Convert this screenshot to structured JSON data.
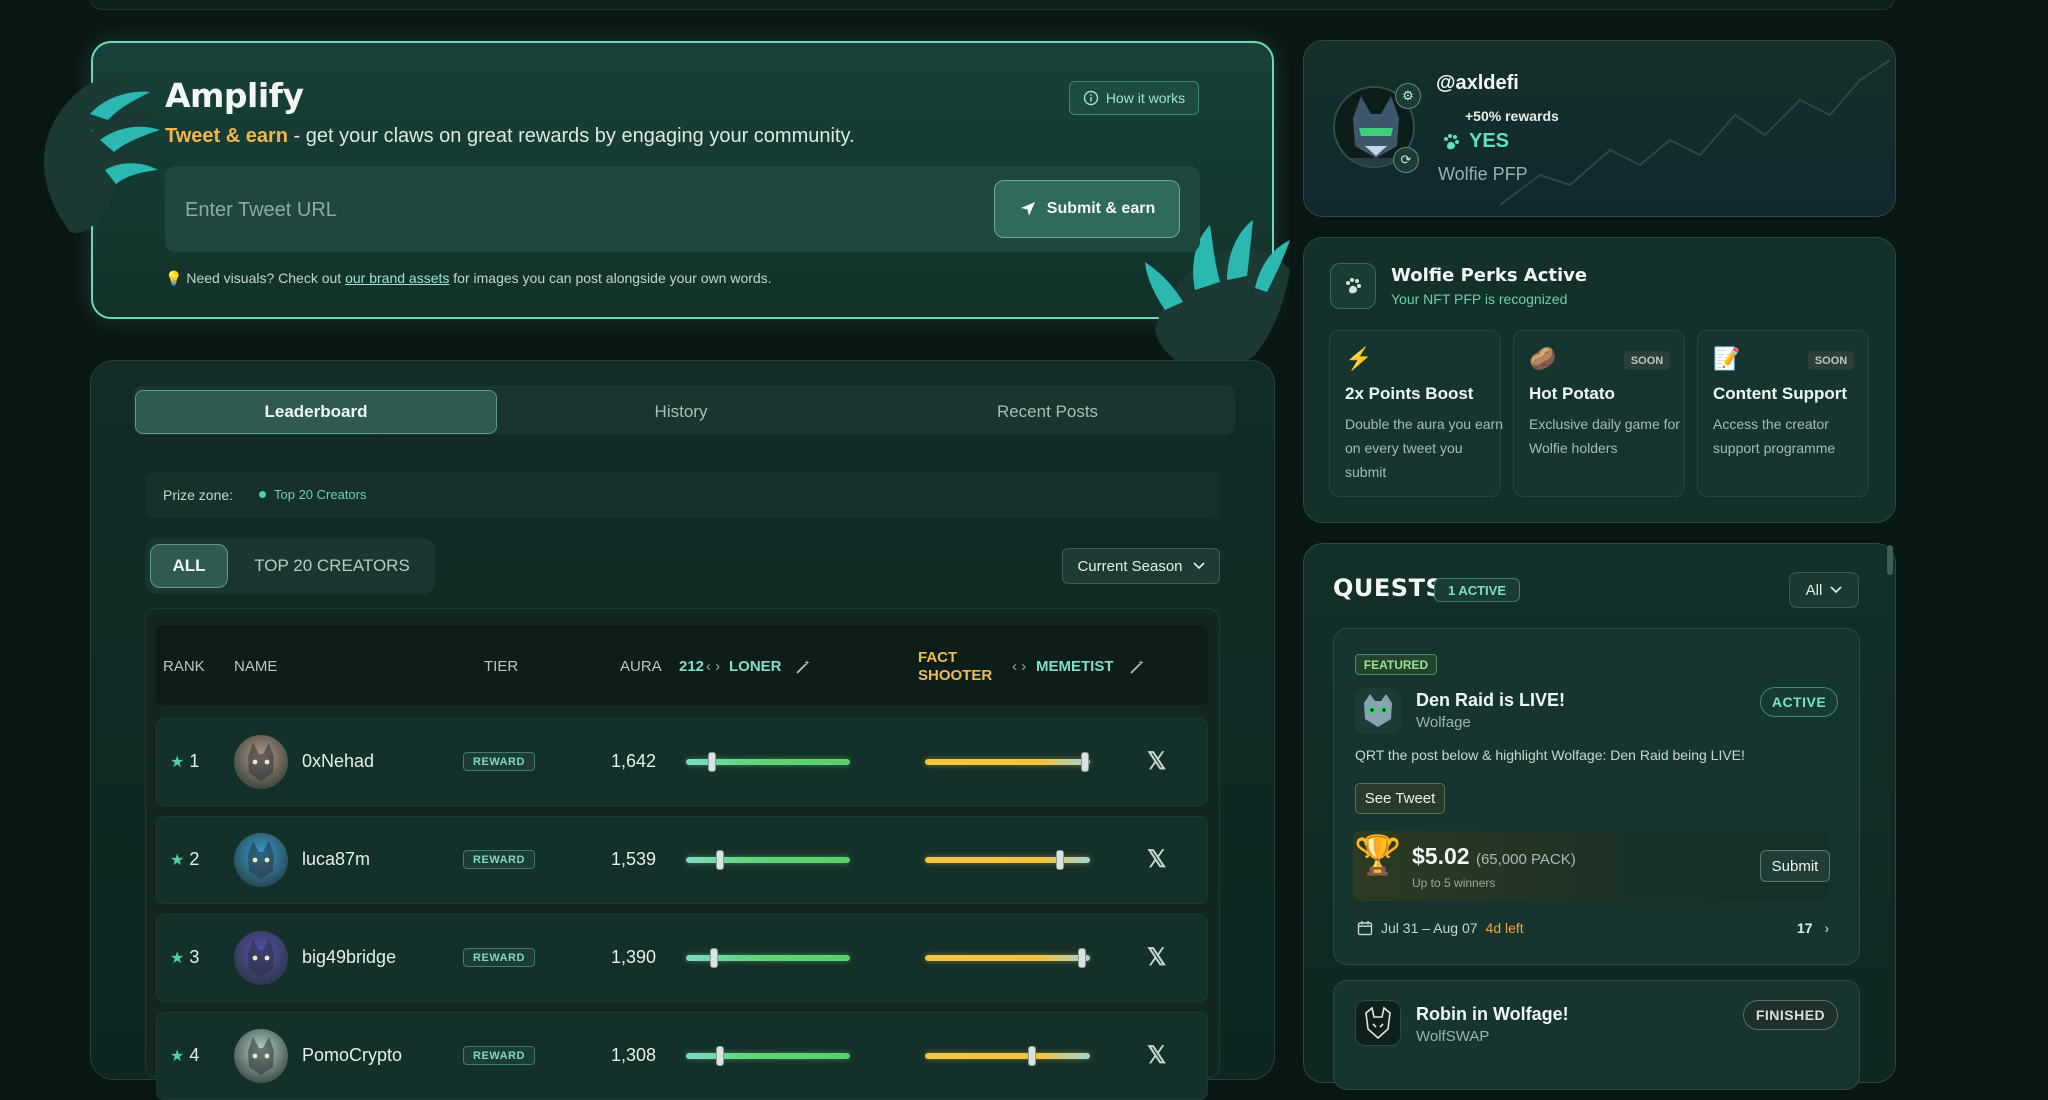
{
  "amplify": {
    "title": "Amplify",
    "subtitle_highlight": "Tweet & earn",
    "subtitle_rest": " - get your claws on great rewards by engaging your community.",
    "how_it_works": "How it works",
    "url_placeholder": "Enter Tweet URL",
    "submit_label": "Submit & earn",
    "note_prefix": "Need visuals? Check out ",
    "note_link": "our brand assets",
    "note_suffix": " for images you can post alongside your own words."
  },
  "tabs": [
    "Leaderboard",
    "History",
    "Recent Posts"
  ],
  "prize_zone": {
    "label": "Prize zone:",
    "value": "Top 20 Creators"
  },
  "filters": {
    "all": "ALL",
    "top": "TOP 20 CREATORS",
    "season": "Current Season"
  },
  "table": {
    "headers": {
      "rank": "RANK",
      "name": "NAME",
      "tier": "TIER",
      "aura": "AURA",
      "aura_count": "212",
      "loner": "LONER",
      "fact_shooter": "FACT SHOOTER",
      "memetist": "MEMETIST"
    },
    "rows": [
      {
        "rank": "1",
        "name": "0xNehad",
        "tier": "REWARD",
        "aura": "1,642",
        "loner_level": 0.16,
        "fact_level": 0.97,
        "avatar_color": "#b89a86"
      },
      {
        "rank": "2",
        "name": "luca87m",
        "tier": "REWARD",
        "aura": "1,539",
        "loner_level": 0.21,
        "fact_level": 0.82,
        "avatar_color": "#3aa0d8"
      },
      {
        "rank": "3",
        "name": "big49bridge",
        "tier": "REWARD",
        "aura": "1,390",
        "loner_level": 0.17,
        "fact_level": 0.95,
        "avatar_color": "#5a4fb8"
      },
      {
        "rank": "4",
        "name": "PomoCrypto",
        "tier": "REWARD",
        "aura": "1,308",
        "loner_level": 0.21,
        "fact_level": 0.65,
        "avatar_color": "#b7d3c6"
      }
    ]
  },
  "profile": {
    "handle": "@axldefi",
    "rewards": "+50% rewards",
    "status": "YES",
    "pfp_label": "Wolfie PFP"
  },
  "perks": {
    "title": "Wolfie Perks Active",
    "subtitle": "Your NFT PFP is recognized",
    "items": [
      {
        "emoji": "⚡",
        "name": "2x Points Boost",
        "desc": "Double the aura you earn on every tweet you submit",
        "soon": ""
      },
      {
        "emoji": "🥔",
        "name": "Hot Potato",
        "desc": "Exclusive daily game for Wolfie holders",
        "soon": "SOON"
      },
      {
        "emoji": "📝",
        "name": "Content Support",
        "desc": "Access the creator support programme",
        "soon": "SOON"
      }
    ]
  },
  "quests": {
    "title": "QUESTS",
    "active_badge": "1 ACTIVE",
    "filter": "All",
    "featured": {
      "badge": "FEATURED",
      "name": "Den Raid is LIVE!",
      "brand": "Wolfage",
      "status": "ACTIVE",
      "desc": "QRT the post below & highlight Wolfage: Den Raid being LIVE!",
      "see_tweet": "See Tweet",
      "amount": "$5.02",
      "pack": "(65,000 PACK)",
      "winners": "Up to 5 winners",
      "submit": "Submit",
      "dates": "Jul 31 – Aug 07",
      "left": "4d left",
      "count": "17"
    },
    "second": {
      "name": "Robin in Wolfage!",
      "brand": "WolfSWAP",
      "status": "FINISHED"
    }
  }
}
